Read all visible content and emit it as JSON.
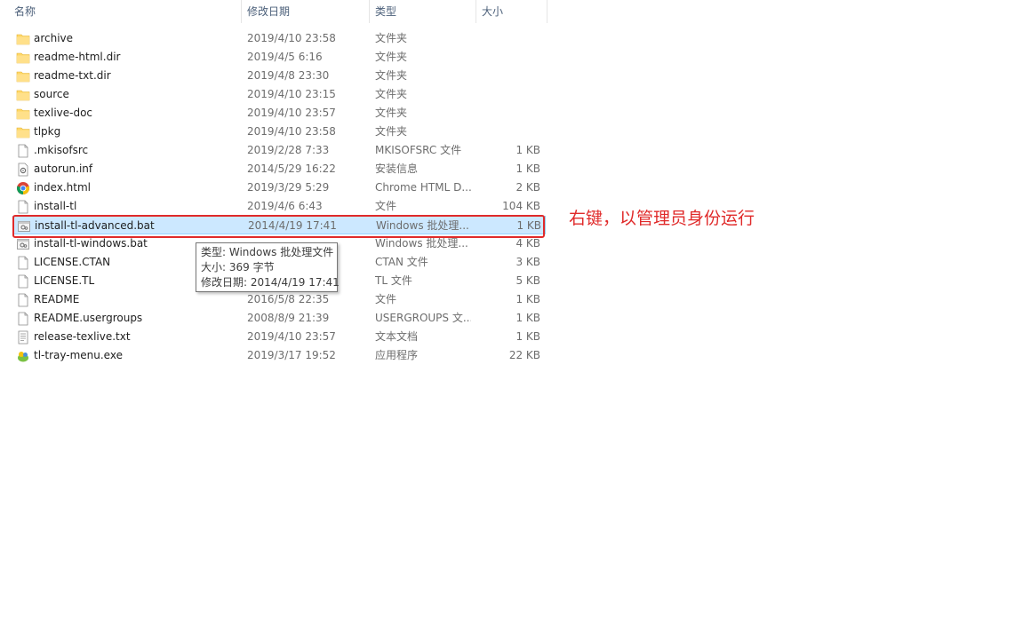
{
  "columns": {
    "name": "名称",
    "date": "修改日期",
    "type": "类型",
    "size": "大小"
  },
  "files": [
    {
      "name": "archive",
      "date": "2019/4/10 23:58",
      "type": "文件夹",
      "size": "",
      "icon": "folder-icon"
    },
    {
      "name": "readme-html.dir",
      "date": "2019/4/5 6:16",
      "type": "文件夹",
      "size": "",
      "icon": "folder-icon"
    },
    {
      "name": "readme-txt.dir",
      "date": "2019/4/8 23:30",
      "type": "文件夹",
      "size": "",
      "icon": "folder-icon"
    },
    {
      "name": "source",
      "date": "2019/4/10 23:15",
      "type": "文件夹",
      "size": "",
      "icon": "folder-icon"
    },
    {
      "name": "texlive-doc",
      "date": "2019/4/10 23:57",
      "type": "文件夹",
      "size": "",
      "icon": "folder-icon"
    },
    {
      "name": "tlpkg",
      "date": "2019/4/10 23:58",
      "type": "文件夹",
      "size": "",
      "icon": "folder-icon"
    },
    {
      "name": ".mkisofsrc",
      "date": "2019/2/28 7:33",
      "type": "MKISOFSRC 文件",
      "size": "1 KB",
      "icon": "file-icon"
    },
    {
      "name": "autorun.inf",
      "date": "2014/5/29 16:22",
      "type": "安装信息",
      "size": "1 KB",
      "icon": "settings-file-icon"
    },
    {
      "name": "index.html",
      "date": "2019/3/29 5:29",
      "type": "Chrome HTML D...",
      "size": "2 KB",
      "icon": "chrome-icon"
    },
    {
      "name": "install-tl",
      "date": "2019/4/6 6:43",
      "type": "文件",
      "size": "104 KB",
      "icon": "file-icon"
    },
    {
      "name": "install-tl-advanced.bat",
      "date": "2014/4/19 17:41",
      "type": "Windows 批处理...",
      "size": "1 KB",
      "icon": "batch-file-icon"
    },
    {
      "name": "install-tl-windows.bat",
      "date": "",
      "type": "Windows 批处理...",
      "size": "4 KB",
      "icon": "batch-file-icon"
    },
    {
      "name": "LICENSE.CTAN",
      "date": "",
      "type": "CTAN 文件",
      "size": "3 KB",
      "icon": "file-icon"
    },
    {
      "name": "LICENSE.TL",
      "date": "",
      "type": "TL 文件",
      "size": "5 KB",
      "icon": "file-icon"
    },
    {
      "name": "README",
      "date": "2016/5/8 22:35",
      "type": "文件",
      "size": "1 KB",
      "icon": "file-icon"
    },
    {
      "name": "README.usergroups",
      "date": "2008/8/9 21:39",
      "type": "USERGROUPS 文...",
      "size": "1 KB",
      "icon": "file-icon"
    },
    {
      "name": "release-texlive.txt",
      "date": "2019/4/10 23:57",
      "type": "文本文档",
      "size": "1 KB",
      "icon": "text-file-icon"
    },
    {
      "name": "tl-tray-menu.exe",
      "date": "2019/3/17 19:52",
      "type": "应用程序",
      "size": "22 KB",
      "icon": "exe-icon"
    }
  ],
  "selected_index": 10,
  "tooltip": {
    "type_line": "类型: Windows 批处理文件",
    "size_line": "大小: 369 字节",
    "date_line": "修改日期: 2014/4/19 17:41"
  },
  "annotation": {
    "text": "右键，以管理员身份运行",
    "color": "#e02a2a"
  },
  "colors": {
    "selection_bg": "#cce8ff",
    "selection_border": "#99d1ff",
    "folder": "#ffd766"
  }
}
